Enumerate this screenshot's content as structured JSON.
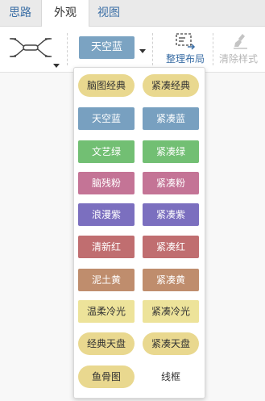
{
  "tabs": [
    {
      "label": "思路",
      "active": false
    },
    {
      "label": "外观",
      "active": true
    },
    {
      "label": "视图",
      "active": false
    }
  ],
  "toolbar": {
    "template_icon": "mindmap-structure-icon",
    "theme_selected": "天空蓝",
    "arrange_label": "整理布局",
    "clear_style_label": "清除样式"
  },
  "colors": {
    "accent": "#3a6ea5",
    "sky_blue": "#7ba3c2",
    "disabled": "#b5b5b5"
  },
  "themes": [
    {
      "label": "脑图经典",
      "bg": "#e9d88f",
      "fg": "#333333",
      "shape": "pill"
    },
    {
      "label": "紧凑经典",
      "bg": "#e9d88f",
      "fg": "#333333",
      "shape": "pill"
    },
    {
      "label": "天空蓝",
      "bg": "#78a0c0",
      "fg": "#ffffff",
      "shape": "rect"
    },
    {
      "label": "紧凑蓝",
      "bg": "#78a0c0",
      "fg": "#ffffff",
      "shape": "rect"
    },
    {
      "label": "文艺绿",
      "bg": "#72bf73",
      "fg": "#ffffff",
      "shape": "rect"
    },
    {
      "label": "紧凑绿",
      "bg": "#72bf73",
      "fg": "#ffffff",
      "shape": "rect"
    },
    {
      "label": "脑残粉",
      "bg": "#c47496",
      "fg": "#ffffff",
      "shape": "rect"
    },
    {
      "label": "紧凑粉",
      "bg": "#c47496",
      "fg": "#ffffff",
      "shape": "rect"
    },
    {
      "label": "浪漫紫",
      "bg": "#7b6fbf",
      "fg": "#ffffff",
      "shape": "rect"
    },
    {
      "label": "紧凑紫",
      "bg": "#7b6fbf",
      "fg": "#ffffff",
      "shape": "rect"
    },
    {
      "label": "清新红",
      "bg": "#c06e70",
      "fg": "#ffffff",
      "shape": "rect"
    },
    {
      "label": "紧凑红",
      "bg": "#c06e70",
      "fg": "#ffffff",
      "shape": "rect"
    },
    {
      "label": "泥土黄",
      "bg": "#bf8d6d",
      "fg": "#ffffff",
      "shape": "rect"
    },
    {
      "label": "紧凑黄",
      "bg": "#bf8d6d",
      "fg": "#ffffff",
      "shape": "rect"
    },
    {
      "label": "温柔冷光",
      "bg": "#ede39a",
      "fg": "#333333",
      "shape": "rect"
    },
    {
      "label": "紧凑冷光",
      "bg": "#ede39a",
      "fg": "#333333",
      "shape": "rect"
    },
    {
      "label": "经典天盘",
      "bg": "#e9d88f",
      "fg": "#333333",
      "shape": "pill"
    },
    {
      "label": "紧凑天盘",
      "bg": "#e9d88f",
      "fg": "#333333",
      "shape": "pill"
    },
    {
      "label": "鱼骨图",
      "bg": "#e9d88f",
      "fg": "#333333",
      "shape": "pill"
    },
    {
      "label": "线框",
      "bg": "#ffffff",
      "fg": "#333333",
      "shape": "rect"
    }
  ]
}
